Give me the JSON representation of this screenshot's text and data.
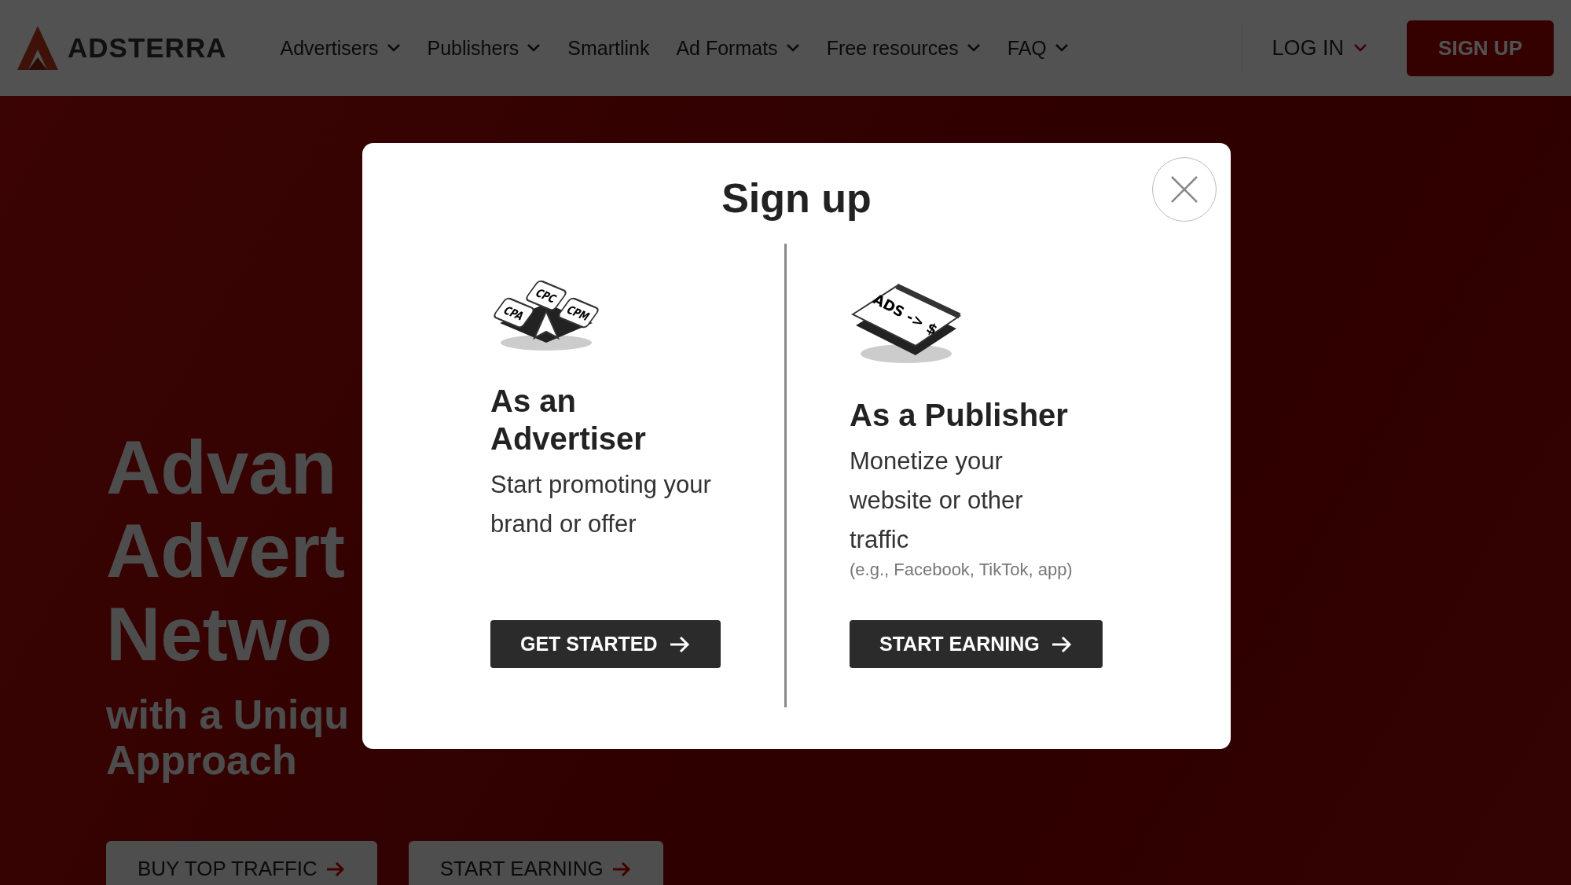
{
  "header": {
    "logo": "ADSTERRA",
    "nav": [
      {
        "label": "Advertisers",
        "dropdown": true
      },
      {
        "label": "Publishers",
        "dropdown": true
      },
      {
        "label": "Smartlink",
        "dropdown": false
      },
      {
        "label": "Ad Formats",
        "dropdown": true
      },
      {
        "label": "Free resources",
        "dropdown": true
      },
      {
        "label": "FAQ",
        "dropdown": true
      }
    ],
    "login": "LOG IN",
    "signup": "SIGN UP"
  },
  "hero": {
    "title_lines": [
      "Advan",
      "Advert",
      "Netwo"
    ],
    "subtitle_lines": [
      "with a Uniqu",
      "Approach"
    ],
    "buttons": [
      "BUY TOP TRAFFIC",
      "START EARNING"
    ]
  },
  "modal": {
    "title": "Sign up",
    "options": [
      {
        "kind": "advertiser",
        "icon_labels": [
          "CPC",
          "CPA",
          "CPM"
        ],
        "heading": "As an Advertiser",
        "text": "Start promoting your brand or offer",
        "button": "GET STARTED"
      },
      {
        "kind": "publisher",
        "icon_labels": [
          "ADS -> $"
        ],
        "heading": "As a Publisher",
        "text": "Monetize your website or other traffic",
        "note": "(e.g., Facebook, TikTok, app)",
        "button": "START EARNING"
      }
    ]
  }
}
